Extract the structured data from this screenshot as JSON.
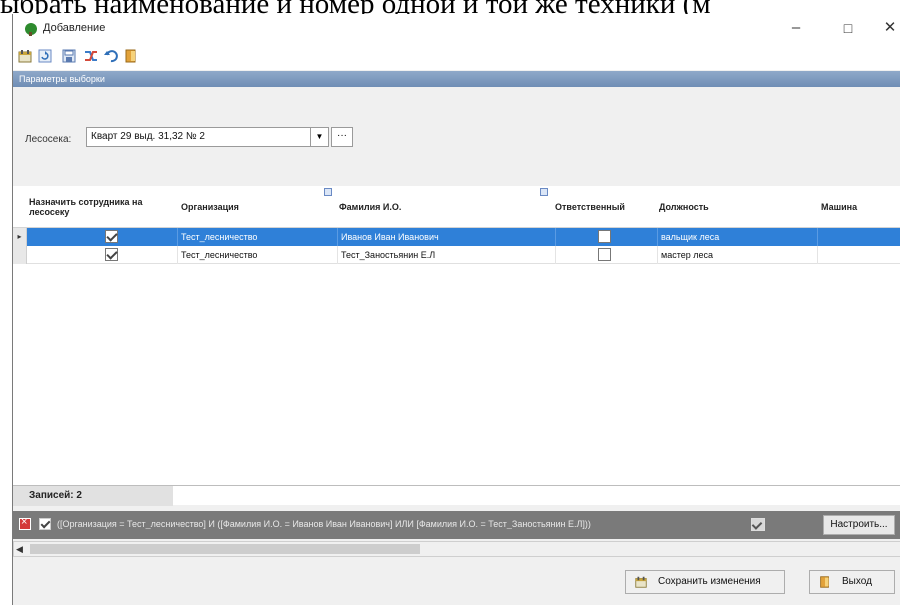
{
  "document": {
    "top_line": "ыбрать наименование и номер одной и той же техники (м"
  },
  "window": {
    "title": "Добавление",
    "minimize": "–",
    "maximize": "□",
    "close": "✕"
  },
  "toolbar": {
    "icons": [
      "calendar-icon",
      "refresh-icon",
      "save-icon",
      "shuffle-icon",
      "undo-icon",
      "exit-icon"
    ]
  },
  "params": {
    "header": "Параметры выборки",
    "lesoseka_label": "Лесосека:",
    "lesoseka_value": "Кварт 29 выд. 31,32 № 2",
    "ellipsis": "···"
  },
  "grid": {
    "columns": [
      {
        "key": "assign",
        "label": "Назначить сотрудника на лесосеку"
      },
      {
        "key": "org",
        "label": "Организация"
      },
      {
        "key": "fio",
        "label": "Фамилия И.О."
      },
      {
        "key": "resp",
        "label": "Ответственный"
      },
      {
        "key": "position",
        "label": "Должность"
      },
      {
        "key": "machine",
        "label": "Машина"
      }
    ],
    "rows": [
      {
        "assign": true,
        "org": "Тест_лесничество",
        "fio": "Иванов Иван Иванович",
        "resp": false,
        "position": "вальщик леса",
        "machine": "",
        "selected": true
      },
      {
        "assign": true,
        "org": "Тест_лесничество",
        "fio": "Тест_Заностьянин Е.Л",
        "resp": false,
        "position": "мастер леса",
        "machine": "",
        "selected": false
      }
    ],
    "records_label": "Записей: 2"
  },
  "filter_bar": {
    "text": "([Организация = Тест_лесничество] И ([Фамилия И.О. = Иванов Иван Иванович] ИЛИ [Фамилия И.О. = Тест_Заностьянин Е.Л]))",
    "customize_label": "Настроить..."
  },
  "footer": {
    "save_label": "Сохранить изменения",
    "exit_label": "Выход"
  },
  "colors": {
    "selection": "#2f80d8",
    "header_band": "#7a96bd",
    "filter_bar": "#7a7a7a"
  }
}
